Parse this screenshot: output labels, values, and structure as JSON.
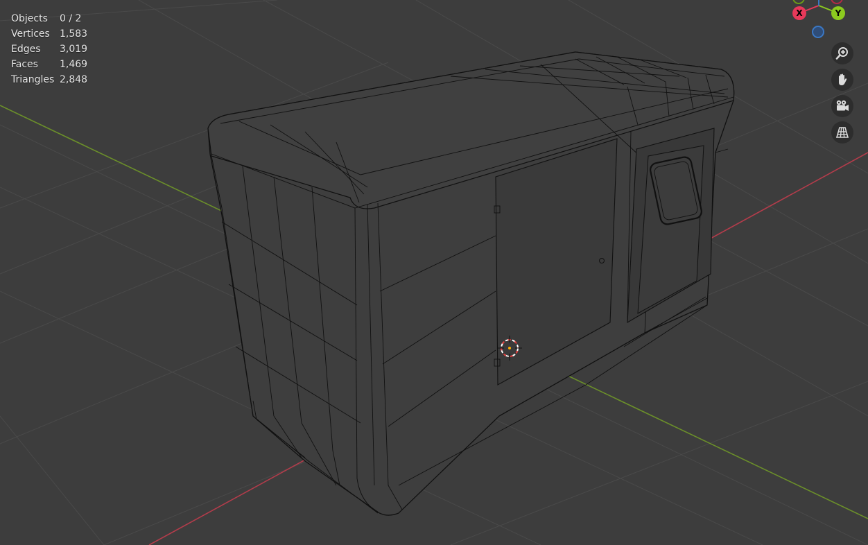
{
  "viewport": {
    "background": "#3d3d3d",
    "grid_color": "#4d4d4d",
    "x_axis_color": "#b43c4b",
    "y_axis_color": "#6b8f2a",
    "wire_color": "#000000"
  },
  "stats": {
    "objects": {
      "label": "Objects",
      "value": "0 / 2"
    },
    "vertices": {
      "label": "Vertices",
      "value": "1,583"
    },
    "edges": {
      "label": "Edges",
      "value": "3,019"
    },
    "faces": {
      "label": "Faces",
      "value": "1,469"
    },
    "triangles": {
      "label": "Triangles",
      "value": "2,848"
    }
  },
  "gizmo": {
    "x_label": "X",
    "y_label": "Y",
    "x_color": "#e8395a",
    "y_color": "#8ccb1f",
    "z_color": "#3b78c4"
  },
  "nav_buttons": [
    {
      "name": "zoom",
      "icon": "zoom-in-icon"
    },
    {
      "name": "pan",
      "icon": "hand-icon"
    },
    {
      "name": "camera",
      "icon": "camera-icon"
    },
    {
      "name": "ortho",
      "icon": "grid-icon"
    }
  ]
}
